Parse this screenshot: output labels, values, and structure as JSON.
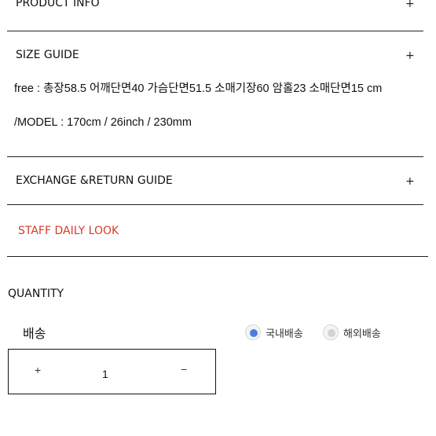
{
  "product_info": {
    "title": "PRODUCT INFO",
    "toggle": "+"
  },
  "size_guide": {
    "title": "SIZE GUIDE",
    "toggle": "+",
    "measurements": "free : 총장58.5 어깨단면40 가슴단면51.5 소매기장60 암홀23 소매단면15 cm",
    "model": "/MODEL : 170cm / 26inch / 230mm"
  },
  "exchange_return": {
    "title": "EXCHANGE &RETURN GUIDE",
    "toggle": "+"
  },
  "staff_daily_look": {
    "title": "STAFF DAILY LOOK",
    "color": "#d93a2b"
  },
  "quantity": {
    "label": "QUANTITY"
  },
  "delivery": {
    "label": "배송",
    "options": [
      {
        "label": "국내배송",
        "selected": true
      },
      {
        "label": "해외배송",
        "selected": false
      }
    ],
    "accent_color": "#4a7fe0"
  },
  "stepper": {
    "increment": "+",
    "value": "1",
    "decrement": "−"
  }
}
